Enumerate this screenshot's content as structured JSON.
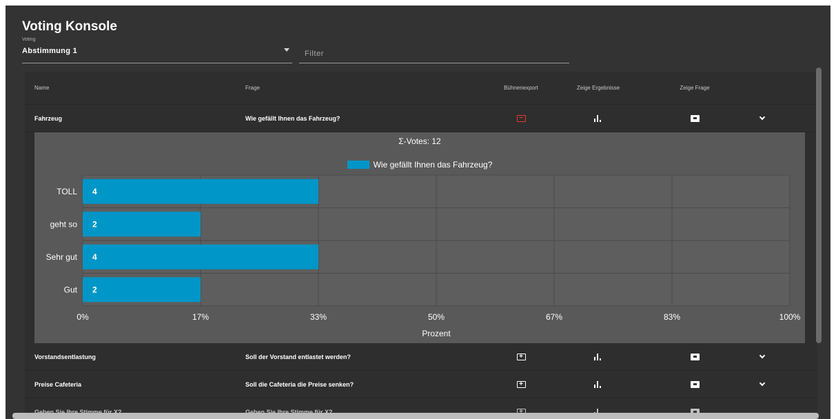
{
  "app": {
    "title": "Voting Konsole"
  },
  "voting": {
    "label": "Voting",
    "value": "Abstimmung 1"
  },
  "filter": {
    "placeholder": "Filter"
  },
  "table": {
    "headers": {
      "name": "Name",
      "frage": "Frage",
      "export": "Bühnenexport",
      "ergebnisse": "Zeige Ergebnisse",
      "zeigefrage": "Zeige Frage"
    },
    "rows": [
      {
        "name": "Fahrzeug",
        "frage": "Wie gefällt Ihnen das Fahrzeug?",
        "export_icon": "present-icon",
        "export_active": true
      },
      {
        "name": "Vorstandsentlastung",
        "frage": "Soll der Vorstand entlastet werden?",
        "export_icon": "present-icon",
        "export_active": false
      },
      {
        "name": "Preise Cafeteria",
        "frage": "Soll die Cafeteria die Preise senken?",
        "export_icon": "present-icon",
        "export_active": false
      },
      {
        "name": "Geben Sie Ihre Stimme für X?",
        "frage": "Geben Sie Ihre Stimme für X?",
        "export_icon": "present-icon",
        "export_active": false
      }
    ]
  },
  "colors": {
    "accent": "#0096c7",
    "active_export": "#e53935",
    "panel": "#595959",
    "background": "#333333"
  },
  "chart_data": {
    "type": "bar",
    "orientation": "horizontal",
    "sum_label": "Σ-Votes: 12",
    "categories": [
      "TOLL",
      "geht so",
      "Sehr gut",
      "Gut"
    ],
    "series": [
      {
        "name": "Wie gefällt Ihnen das Fahrzeug?",
        "values": [
          4,
          2,
          4,
          2
        ]
      }
    ],
    "percent_of_total": [
      33.3,
      16.7,
      33.3,
      16.7
    ],
    "xticks": [
      "0%",
      "17%",
      "33%",
      "50%",
      "67%",
      "83%",
      "100%"
    ],
    "xlabel": "Prozent",
    "xlim": [
      0,
      100
    ],
    "grid": true,
    "legend": "top-center"
  }
}
